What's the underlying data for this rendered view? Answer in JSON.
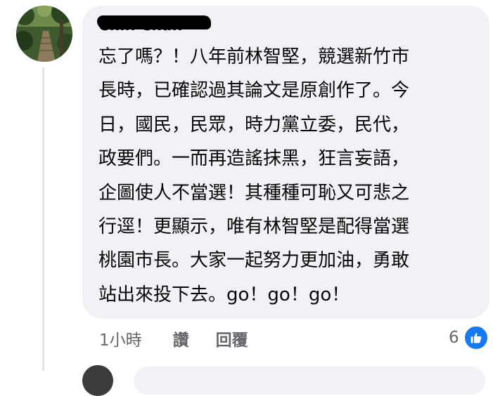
{
  "comment": {
    "author": "Chih Chan",
    "lines": [
      "忘了嗎？！八年前林智堅，競選新竹市",
      "長時，已確認過其論文是原創作了。今",
      "日，國民，民眾，時力黨立委，民代，",
      "政要們。一而再造謠抹黑，狂言妄語，",
      "企圖使人不當選！其種種可恥又可悲之",
      "行逕！更顯示，唯有林智堅是配得當選",
      "桃園市長。大家一起努力更加油，勇敢",
      "站出來投下去。go！go！go！"
    ]
  },
  "actions": {
    "timestamp": "1小時",
    "like_label": "讚",
    "reply_label": "回覆"
  },
  "reactions": {
    "count": "6",
    "icon": "like-thumb-icon"
  },
  "colors": {
    "bubble": "#f0f2f5",
    "secondary_text": "#65676b",
    "like_blue": "#1877f2"
  }
}
